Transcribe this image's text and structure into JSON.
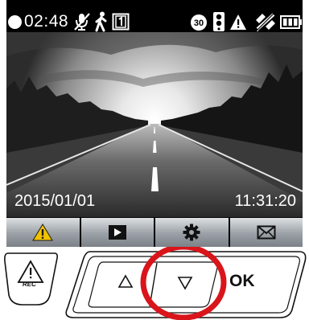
{
  "status_bar": {
    "record_indicator_icon": "white-circle",
    "time": "02:48",
    "icons": [
      "mute-mic-icon",
      "pedestrian-icon",
      "card-1-icon",
      "30-fps-icon",
      "traffic-light-icon",
      "warning-icon",
      "gps-satellite-icon",
      "battery-icon"
    ]
  },
  "camera_view": {
    "date": "2015/01/01",
    "time": "11:31:20"
  },
  "menu_bar": {
    "items": [
      {
        "icon": "warning-icon",
        "active": true
      },
      {
        "icon": "playback-icon",
        "active": false
      },
      {
        "icon": "gear-icon",
        "active": false
      },
      {
        "icon": "mail-icon",
        "active": false
      }
    ],
    "active_color": "#f2c200"
  },
  "hardware_buttons": {
    "rec_label": "REC",
    "up_icon": "triangle-up-icon",
    "down_icon": "triangle-down-icon",
    "ok_label": "OK",
    "highlight": {
      "target": "down-button",
      "color": "#d9141b"
    }
  }
}
